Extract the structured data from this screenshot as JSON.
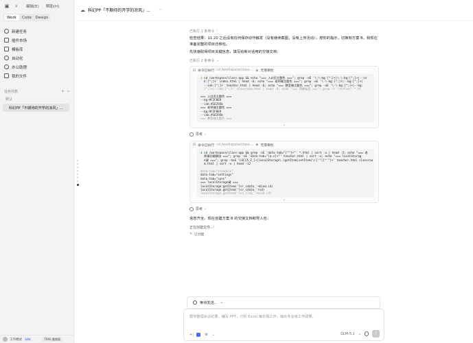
{
  "sidebar": {
    "menus": [
      "编辑(E)",
      "帮助(H)"
    ],
    "modes": [
      "Work",
      "Code",
      "Design"
    ],
    "active_mode": "Work",
    "nav": [
      {
        "label": "新建任务",
        "icon": "plus-circle-icon"
      },
      {
        "label": "插件市场",
        "icon": "grid-icon"
      },
      {
        "label": "模板库",
        "icon": "template-icon"
      },
      {
        "label": "自动化",
        "icon": "automation-icon"
      },
      {
        "label": "办公助理",
        "icon": "assistant-icon"
      },
      {
        "label": "我的文件",
        "icon": "folder-icon"
      }
    ],
    "tasks_title": "任务列表",
    "task_group": "默认",
    "task_item": "科幻PP「不期待的开学的凉风」...",
    "footer": {
      "user": "工作模式",
      "badge": "Lite",
      "brand": "TRAE 截图版"
    }
  },
  "header": {
    "title": "科幻PP「不期待的开学的凉风」...",
    "more": "···"
  },
  "chat": {
    "meta1": "已执行 1 条命令",
    "para1": "检查结果：11:20 之后没有任何保存动作触发（没有继续截图，没有上传活动），按你的指示，切换到方案 B，我现在准备完整的项目迁移包。",
    "para2": "先快速取得项目关键信息，填写给新对话用的交接文档：",
    "meta2": "已执行 2 条命令",
    "cmd1": {
      "label": "命令已执行",
      "path": "cd /workspace/class-...",
      "status": "无需审批",
      "code": [
        "cd /workspace/class-app && echo \"=== 入口页主题色 ===\"; grep -oE '\\-\\-bg:[^;]+|\\-\\-bg:[^;]+|--in",
        "k:[^;]+' index.html | head -6; echo \"=== 老师端主题色 ===\"; grep -oE '\\-\\-bg:[^;]+|--bg:[^;]+|",
        "--ink:[^;]+' teacher.html | head -6; echo \"=== 教室端主题色 ===\"; grep -oE '\\-\\-bg:[^;]+|--bg:",
        "[^;]+|--ink:[^;]+' classroom.html | head -6; echo \"=== 四端标签 ===\"; grep -h \"<title>\" *.ht"
      ],
      "output": [
        "=== 入口页主题色 ===",
        "--bg:#F2F0E9",
        "--ink:#1E293b",
        "=== 老师端主题色 ===",
        "--bg:#F2F0E9",
        "--ink:#1E293b",
        "=== 教室端主题色 ==="
      ]
    },
    "think1": "思考",
    "cmd2": {
      "label": "命令已执行",
      "path": "cd /workspace/class-...",
      "status": "无需审批",
      "code": [
        "cd /workspace/class-app && grep -oE 'data-tab=\"[^\"]+\"' *.html | sort -u | head -5; echo \"=== 老",
        "师端功能模块 ===\"; grep -oE 'data-tab=\"[a-z]+\"' teacher.html | sort -u; echo \"=== localStorag",
        "e键 ===\"; grep -hoE 'LSC[A-Z_]+|localStorage\\.(getItem|setItem)\\(['\"][^'\"]+' teacher.html classroo",
        "m.html | sort -u | head -12"
      ],
      "output": [
        "data-tab=\"schedule\"",
        "data-tab=\"settings\"",
        "data-tab=\"sync\"",
        "=== localStorage键 ===",
        "localStorage.getItem('lsr_cdata_'+bind.id)",
        "localStorage.getItem('lsr_cdata_'+id)",
        "localStorage.getItem('lsr_cloq_'+bind.id)"
      ]
    },
    "think2": "思考",
    "para3": "信息齐全。现在创建方案 B 的交接文档和导入包：",
    "status": "正在创建文件...",
    "create_link": "已创建"
  },
  "composer": {
    "waiting": "等待发送...",
    "placeholder": "帮你整理会议纪要，编写 PPT，分析 Excel 每日周工作，输出专业级工作成果。",
    "model": "GLM-5.1",
    "send": "↑"
  }
}
